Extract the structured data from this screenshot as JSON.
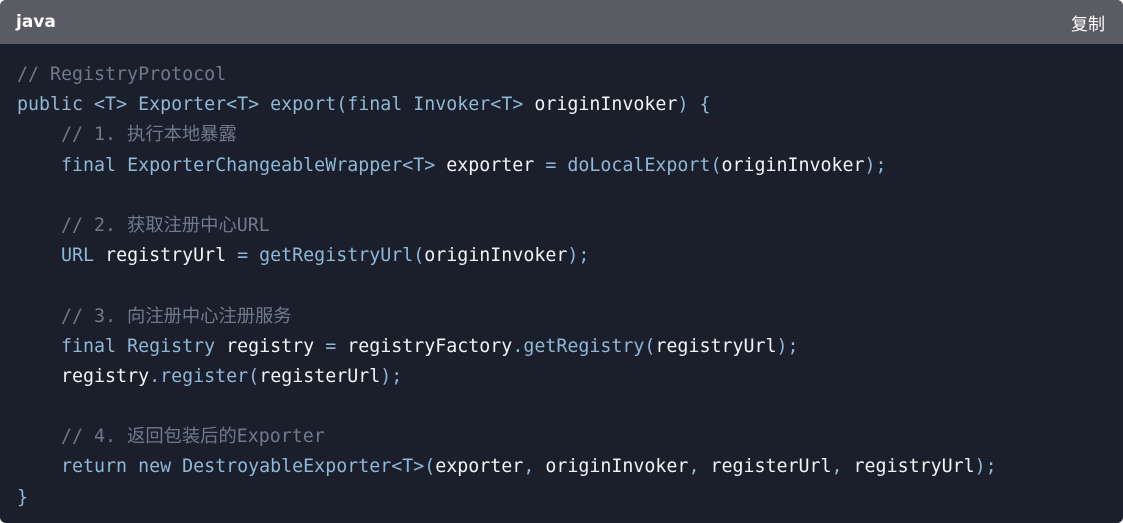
{
  "header": {
    "language": "java",
    "copy_label": "复制"
  },
  "theme": {
    "background": "#1b1f2b",
    "header_background": "#5a5b63",
    "comment": "#6e7a8c",
    "keyword": "#8fb7d6",
    "identifier": "#f1f3f6"
  },
  "code": {
    "lines": [
      [
        {
          "t": "// RegistryProtocol",
          "c": "comment"
        }
      ],
      [
        {
          "t": "public ",
          "c": "keyword"
        },
        {
          "t": "<T> ",
          "c": "type"
        },
        {
          "t": "Exporter<T> ",
          "c": "type"
        },
        {
          "t": "export",
          "c": "func"
        },
        {
          "t": "(",
          "c": "punct"
        },
        {
          "t": "final ",
          "c": "keyword"
        },
        {
          "t": "Invoker<T> ",
          "c": "type"
        },
        {
          "t": "originInvoker",
          "c": "ident"
        },
        {
          "t": ") {",
          "c": "punct"
        }
      ],
      [
        {
          "t": "    // 1. 执行本地暴露",
          "c": "comment"
        }
      ],
      [
        {
          "t": "    ",
          "c": "ident"
        },
        {
          "t": "final ",
          "c": "keyword"
        },
        {
          "t": "ExporterChangeableWrapper<T> ",
          "c": "type"
        },
        {
          "t": "exporter ",
          "c": "ident"
        },
        {
          "t": "= ",
          "c": "punct"
        },
        {
          "t": "doLocalExport",
          "c": "func"
        },
        {
          "t": "(",
          "c": "punct"
        },
        {
          "t": "originInvoker",
          "c": "ident"
        },
        {
          "t": ");",
          "c": "punct"
        }
      ],
      [],
      [
        {
          "t": "    // 2. 获取注册中心URL",
          "c": "comment"
        }
      ],
      [
        {
          "t": "    ",
          "c": "ident"
        },
        {
          "t": "URL ",
          "c": "type"
        },
        {
          "t": "registryUrl ",
          "c": "ident"
        },
        {
          "t": "= ",
          "c": "punct"
        },
        {
          "t": "getRegistryUrl",
          "c": "func"
        },
        {
          "t": "(",
          "c": "punct"
        },
        {
          "t": "originInvoker",
          "c": "ident"
        },
        {
          "t": ");",
          "c": "punct"
        }
      ],
      [],
      [
        {
          "t": "    // 3. 向注册中心注册服务",
          "c": "comment"
        }
      ],
      [
        {
          "t": "    ",
          "c": "ident"
        },
        {
          "t": "final ",
          "c": "keyword"
        },
        {
          "t": "Registry ",
          "c": "type"
        },
        {
          "t": "registry ",
          "c": "ident"
        },
        {
          "t": "= ",
          "c": "punct"
        },
        {
          "t": "registryFactory",
          "c": "ident"
        },
        {
          "t": ".",
          "c": "punct"
        },
        {
          "t": "getRegistry",
          "c": "func"
        },
        {
          "t": "(",
          "c": "punct"
        },
        {
          "t": "registryUrl",
          "c": "ident"
        },
        {
          "t": ");",
          "c": "punct"
        }
      ],
      [
        {
          "t": "    ",
          "c": "ident"
        },
        {
          "t": "registry",
          "c": "ident"
        },
        {
          "t": ".",
          "c": "punct"
        },
        {
          "t": "register",
          "c": "func"
        },
        {
          "t": "(",
          "c": "punct"
        },
        {
          "t": "registerUrl",
          "c": "ident"
        },
        {
          "t": ");",
          "c": "punct"
        }
      ],
      [],
      [
        {
          "t": "    // 4. 返回包装后的Exporter",
          "c": "comment"
        }
      ],
      [
        {
          "t": "    ",
          "c": "ident"
        },
        {
          "t": "return ",
          "c": "keyword"
        },
        {
          "t": "new ",
          "c": "keyword"
        },
        {
          "t": "DestroyableExporter<T>",
          "c": "type"
        },
        {
          "t": "(",
          "c": "punct"
        },
        {
          "t": "exporter",
          "c": "ident"
        },
        {
          "t": ", ",
          "c": "punct"
        },
        {
          "t": "originInvoker",
          "c": "ident"
        },
        {
          "t": ", ",
          "c": "punct"
        },
        {
          "t": "registerUrl",
          "c": "ident"
        },
        {
          "t": ", ",
          "c": "punct"
        },
        {
          "t": "registryUrl",
          "c": "ident"
        },
        {
          "t": ");",
          "c": "punct"
        }
      ],
      [
        {
          "t": "}",
          "c": "punct"
        }
      ]
    ]
  }
}
